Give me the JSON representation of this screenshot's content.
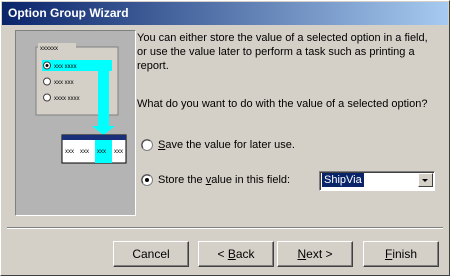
{
  "window": {
    "title": "Option Group Wizard"
  },
  "illustration": {
    "group_label": "xxxxxx",
    "options": [
      "xxx xxxx",
      "xxx xxx",
      "xxxx xxxx"
    ],
    "table_row": [
      "xxx",
      "xxx",
      "xxx",
      "xxx",
      "xxx"
    ]
  },
  "main": {
    "description": "You can either store the value of a selected option in a field, or use the value later to perform a task such as printing a report.",
    "question": "What do you want to do with the value of a selected option?",
    "option_save": {
      "prefix": "",
      "mnemonic": "S",
      "suffix": "ave the value for later use.",
      "selected": false
    },
    "option_store": {
      "prefix": "Store the ",
      "mnemonic": "v",
      "suffix": "alue in this field:",
      "selected": true
    },
    "field_combo": {
      "value": "ShipVia"
    }
  },
  "buttons": {
    "cancel": "Cancel",
    "back_mnemonic": "B",
    "back_prefix": "< ",
    "back_suffix": "ack",
    "next_mnemonic": "N",
    "next_suffix": "ext >",
    "finish_mnemonic": "F",
    "finish_suffix": "inish"
  }
}
